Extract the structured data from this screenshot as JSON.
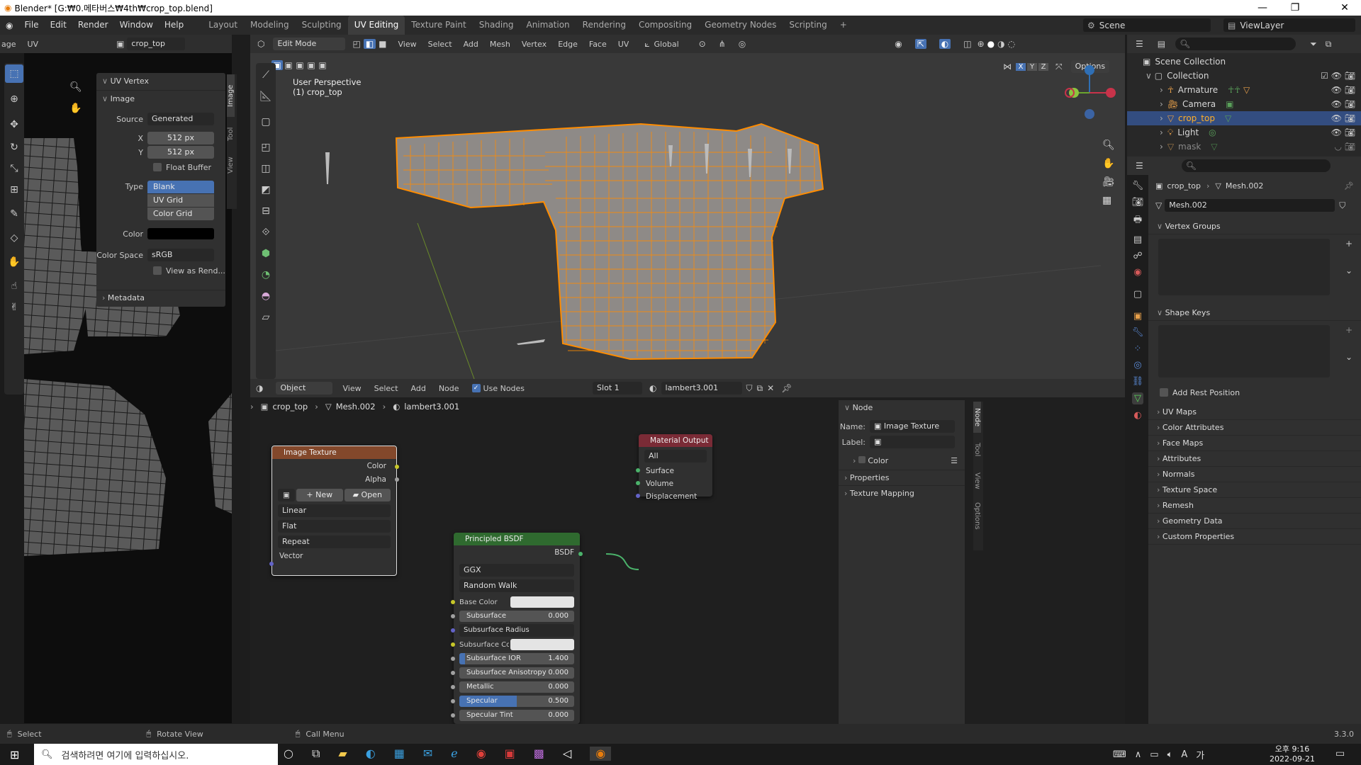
{
  "window": {
    "title": "Blender* [G:₩0.메타버스₩4th₩crop_top.blend]",
    "minimize": "—",
    "maximize": "❐",
    "close": "✕"
  },
  "menus": [
    "File",
    "Edit",
    "Render",
    "Window",
    "Help"
  ],
  "workspaces": [
    "Layout",
    "Modeling",
    "Sculpting",
    "UV Editing",
    "Texture Paint",
    "Shading",
    "Animation",
    "Rendering",
    "Compositing",
    "Geometry Nodes",
    "Scripting"
  ],
  "active_workspace": "UV Editing",
  "scene": {
    "label": "Scene",
    "view_layer": "ViewLayer"
  },
  "uv_editor": {
    "header": {
      "mode": "age",
      "uv_menu": "UV",
      "image_name": "crop_top"
    },
    "n_panel": {
      "section": "UV Vertex",
      "subsection": "Image",
      "source_label": "Source",
      "source_value": "Generated",
      "x_label": "X",
      "x_value": "512 px",
      "y_label": "Y",
      "y_value": "512 px",
      "float_buffer": "Float Buffer",
      "type_label": "Type",
      "types": [
        "Blank",
        "UV Grid",
        "Color Grid"
      ],
      "type_selected": "Blank",
      "color_label": "Color",
      "color_space_label": "Color Space",
      "color_space_value": "sRGB",
      "view_as_render": "View as Rend...",
      "metadata": "Metadata",
      "tabs": [
        "Image",
        "Tool",
        "View"
      ]
    }
  },
  "viewport": {
    "mode": "Edit Mode",
    "menus": [
      "View",
      "Select",
      "Add",
      "Mesh",
      "Vertex",
      "Edge",
      "Face",
      "UV"
    ],
    "orientation": "Global",
    "perspective": "User Perspective",
    "object": "(1) crop_top",
    "axes": [
      "X",
      "Y",
      "Z"
    ],
    "options": "Options"
  },
  "node_editor": {
    "object_mode": "Object",
    "menus": [
      "View",
      "Select",
      "Add",
      "Node"
    ],
    "use_nodes": "Use Nodes",
    "slot": "Slot 1",
    "material": "lambert3.001",
    "breadcrumb": [
      "crop_top",
      "Mesh.002",
      "lambert3.001"
    ],
    "image_texture": {
      "title": "Image Texture",
      "outputs": [
        "Color",
        "Alpha"
      ],
      "new": "New",
      "open": "Open",
      "interp": "Linear",
      "proj": "Flat",
      "ext": "Repeat",
      "input": "Vector"
    },
    "principled": {
      "title": "Principled BSDF",
      "output": "BSDF",
      "dist": "GGX",
      "sss_method": "Random Walk",
      "rows": [
        {
          "label": "Base Color",
          "type": "color"
        },
        {
          "label": "Subsurface",
          "value": "0.000"
        },
        {
          "label": "Subsurface Radius",
          "type": "dd"
        },
        {
          "label": "Subsurface Co...",
          "type": "color"
        },
        {
          "label": "Subsurface IOR",
          "value": "1.400",
          "fill": 0.05
        },
        {
          "label": "Subsurface Anisotropy",
          "value": "0.000"
        },
        {
          "label": "Metallic",
          "value": "0.000"
        },
        {
          "label": "Specular",
          "value": "0.500",
          "fill": 0.5
        },
        {
          "label": "Specular Tint",
          "value": "0.000"
        }
      ]
    },
    "material_output": {
      "title": "Material Output",
      "target": "All",
      "inputs": [
        "Surface",
        "Volume",
        "Displacement"
      ]
    },
    "side_panel": {
      "section": "Node",
      "name_label": "Name:",
      "name_value": "Image Texture",
      "label_label": "Label:",
      "color": "Color",
      "properties": "Properties",
      "texture_mapping": "Texture Mapping",
      "tabs": [
        "Node",
        "Tool",
        "View",
        "Options"
      ]
    }
  },
  "outliner": {
    "root": "Scene Collection",
    "collection": "Collection",
    "items": [
      "Armature",
      "Camera",
      "crop_top",
      "Light",
      "mask"
    ],
    "selected": "crop_top"
  },
  "properties": {
    "breadcrumb": [
      "crop_top",
      "Mesh.002"
    ],
    "mesh": "Mesh.002",
    "sections_open": [
      "Vertex Groups",
      "Shape Keys"
    ],
    "add_rest": "Add Rest Position",
    "sections": [
      "UV Maps",
      "Color Attributes",
      "Face Maps",
      "Attributes",
      "Normals",
      "Texture Space",
      "Remesh",
      "Geometry Data",
      "Custom Properties"
    ]
  },
  "status": {
    "select": "Select",
    "rotate": "Rotate View",
    "call_menu": "Call Menu",
    "version": "3.3.0"
  },
  "taskbar": {
    "search": "검색하려면 여기에 입력하십시오.",
    "time": "오후 9:16",
    "date": "2022-09-21",
    "ime": "A",
    "lang": "가"
  },
  "colors": {
    "accent": "#4772b3",
    "selected_row": "#334d80",
    "orange": "#ff8c00",
    "node_texture": "#83482b",
    "node_shader": "#2f6a2f",
    "node_output": "#7a2b36"
  }
}
